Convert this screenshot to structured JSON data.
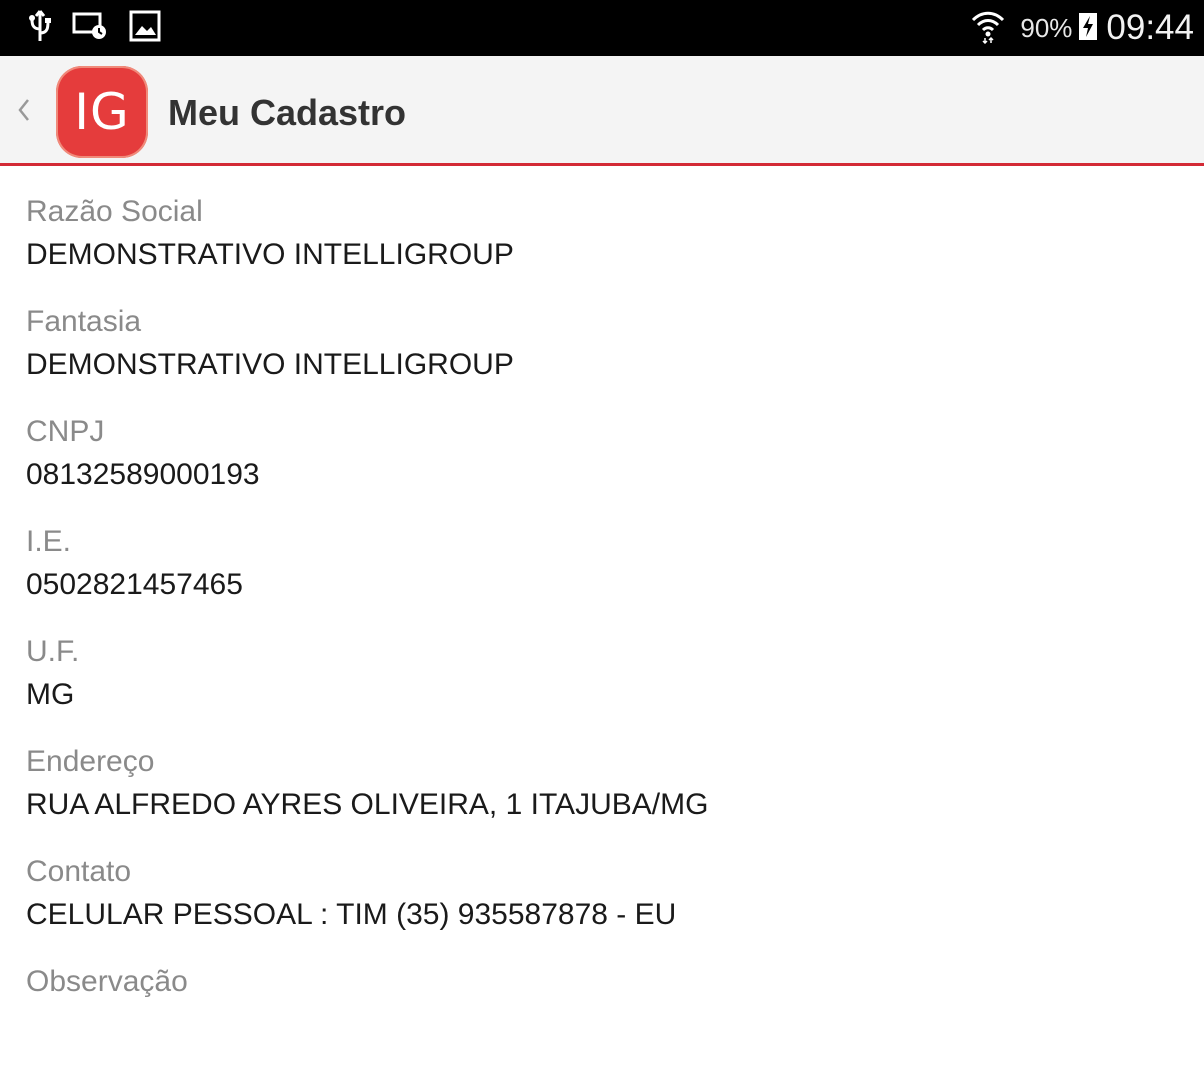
{
  "status_bar": {
    "left_icons": [
      "usb-icon",
      "cast-screen-icon",
      "image-icon"
    ],
    "wifi_icon": "wifi-icon",
    "battery_percent": "90%",
    "battery_icon": "battery-charging-icon",
    "time": "09:44"
  },
  "action_bar": {
    "back_icon": "chevron-left-icon",
    "logo_text": "IG",
    "title": "Meu Cadastro",
    "accent_color": "#d32a35"
  },
  "fields": [
    {
      "label": "Razão Social",
      "value": "DEMONSTRATIVO INTELLIGROUP"
    },
    {
      "label": "Fantasia",
      "value": "DEMONSTRATIVO INTELLIGROUP"
    },
    {
      "label": "CNPJ",
      "value": "08132589000193"
    },
    {
      "label": "I.E.",
      "value": "0502821457465"
    },
    {
      "label": "U.F.",
      "value": "MG"
    },
    {
      "label": "Endereço",
      "value": "RUA ALFREDO AYRES OLIVEIRA, 1 ITAJUBA/MG"
    },
    {
      "label": "Contato",
      "value": "CELULAR PESSOAL : TIM (35) 935587878 - EU"
    },
    {
      "label": "Observação",
      "value": ""
    }
  ]
}
